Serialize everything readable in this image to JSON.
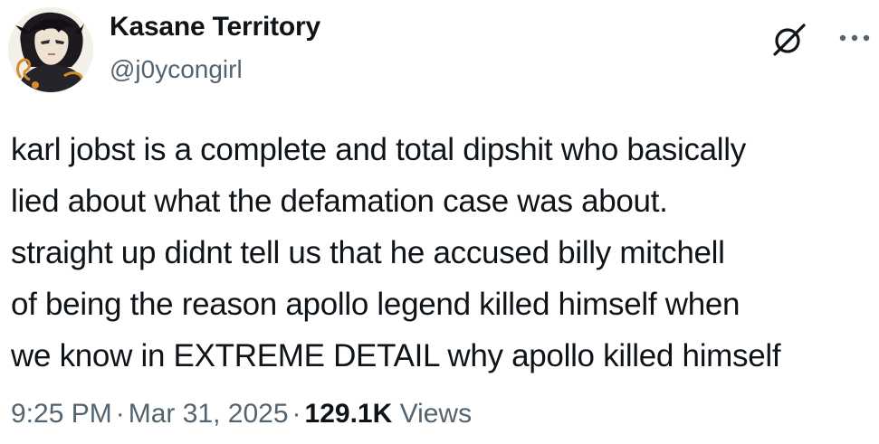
{
  "author": {
    "display_name": "Kasane Territory",
    "handle": "@j0ycongirl"
  },
  "icons": {
    "grok": "grok-icon",
    "more": "more-icon"
  },
  "tweet": {
    "lines": [
      "karl jobst is a complete and total dipshit who basically",
      "lied about what the defamation case was about.",
      "straight up didnt tell us that he accused billy mitchell",
      "of being the reason apollo legend killed himself when",
      "we know in EXTREME DETAIL why apollo killed himself"
    ]
  },
  "meta": {
    "time": "9:25 PM",
    "separator": "·",
    "date": "Mar 31, 2025",
    "views_count": "129.1K",
    "views_label": "Views"
  },
  "colors": {
    "text": "#0f1419",
    "secondary": "#536471",
    "background": "#ffffff"
  }
}
